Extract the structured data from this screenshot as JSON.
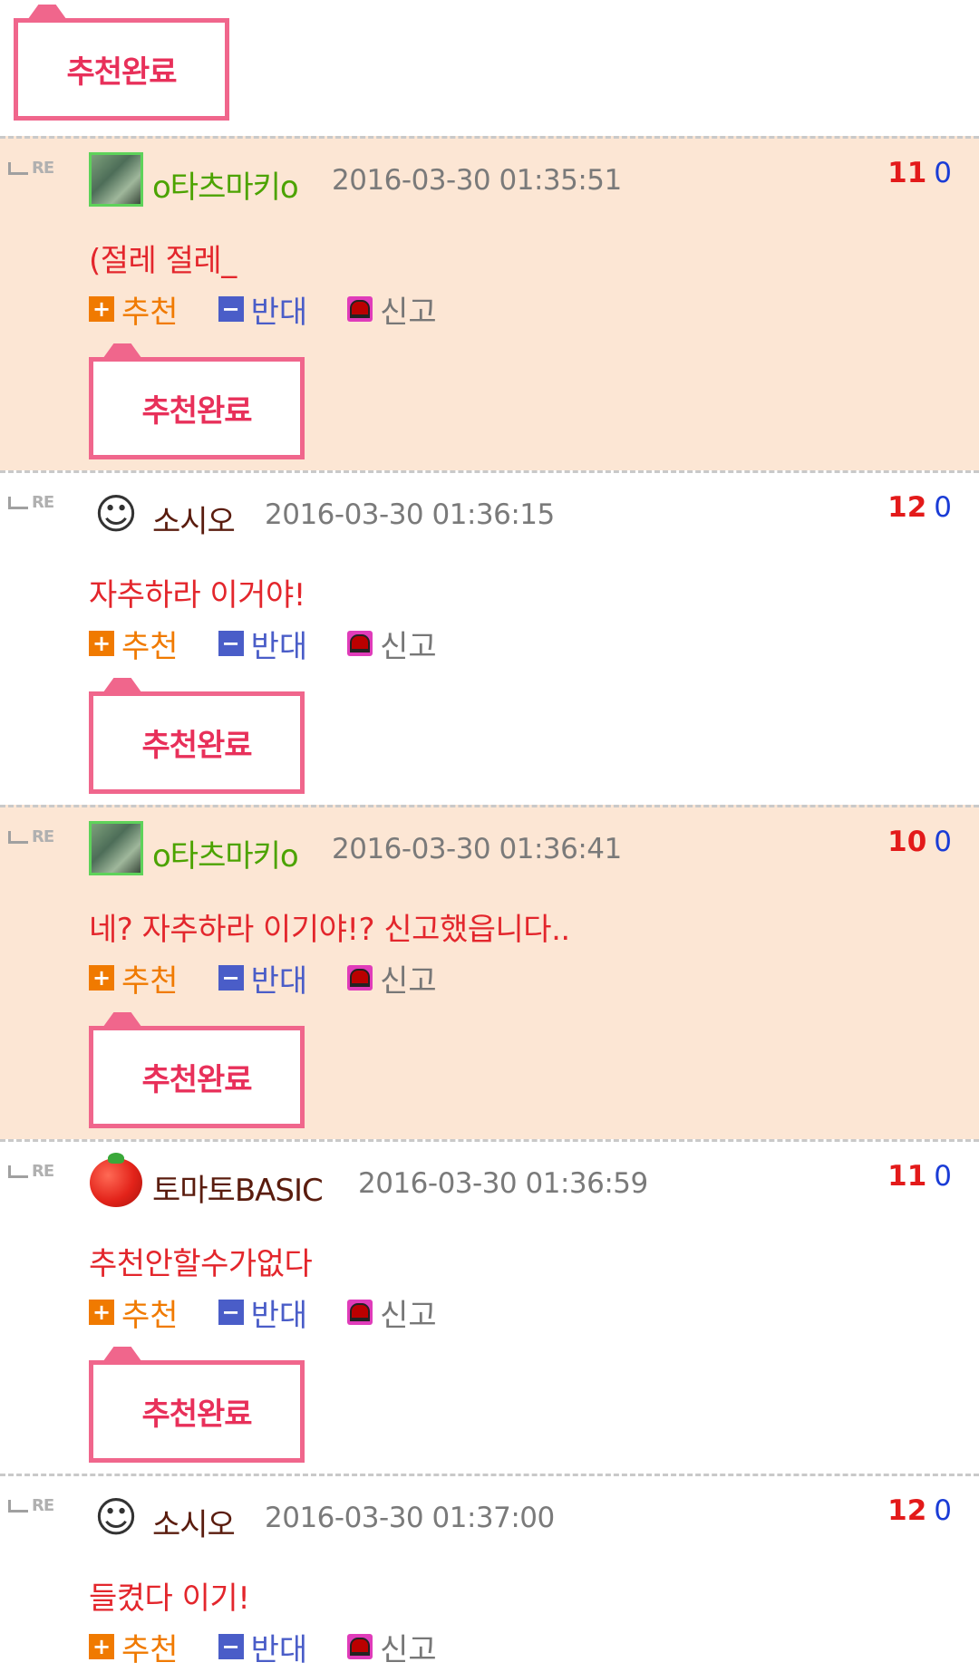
{
  "top": {
    "done_label": "추천완료"
  },
  "actions": {
    "recommend": "추천",
    "oppose": "반대",
    "report": "신고",
    "done": "추천완료",
    "re": "RE"
  },
  "comments": [
    {
      "avatar": "kid-avatar",
      "nick": "o타츠마키o",
      "date": "2016-03-30 01:35:51",
      "up": "11",
      "down": "0",
      "text": "(절레 절레_"
    },
    {
      "avatar": "graduate-avatar",
      "nick": "소시오",
      "date": "2016-03-30 01:36:15",
      "up": "12",
      "down": "0",
      "text": "자추하라 이거야!"
    },
    {
      "avatar": "kid-avatar",
      "nick": "o타츠마키o",
      "date": "2016-03-30 01:36:41",
      "up": "10",
      "down": "0",
      "text": "네? 자추하라 이기야!? 신고했읍니다.."
    },
    {
      "avatar": "tomato-avatar",
      "nick": "토마토BASIC",
      "date": "2016-03-30 01:36:59",
      "up": "11",
      "down": "0",
      "text": "추천안할수가없다"
    },
    {
      "avatar": "graduate-avatar",
      "nick": "소시오",
      "date": "2016-03-30 01:37:00",
      "up": "12",
      "down": "0",
      "text": "들켰다 이기!"
    }
  ],
  "colors": {
    "highlight": "#fce6d4",
    "done_border": "#f0668c",
    "recommend": "#f07a00",
    "oppose": "#4a5dc8",
    "content": "#e3262c"
  }
}
